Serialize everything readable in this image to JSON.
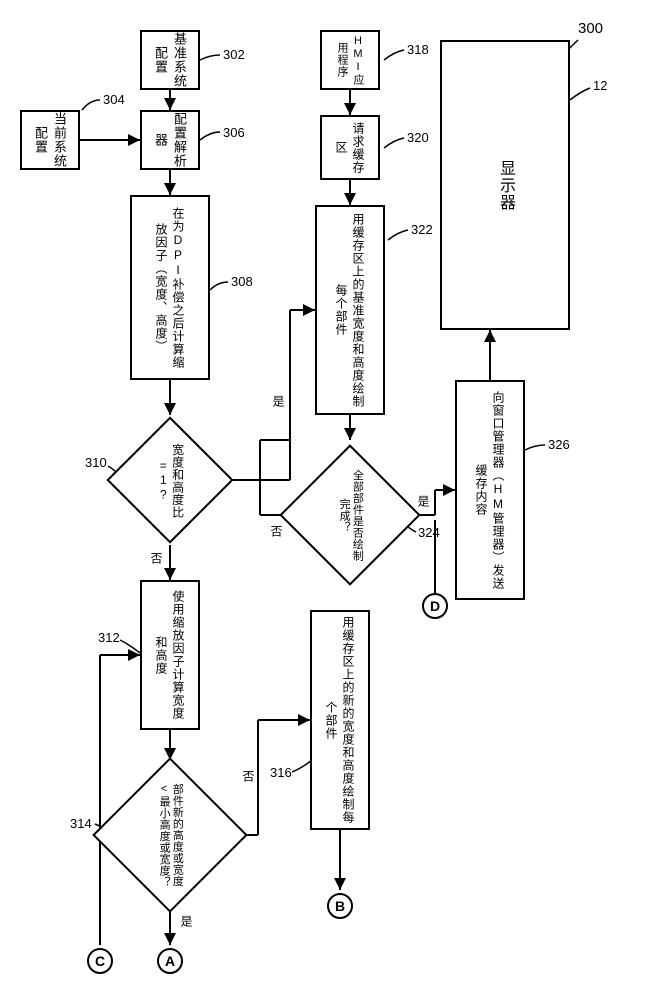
{
  "figure_id": "300",
  "nodes": {
    "n302": {
      "id": "302",
      "text": "基准系统配置"
    },
    "n304": {
      "id": "304",
      "text": "当前系统配置"
    },
    "n306": {
      "id": "306",
      "text": "配置解析器"
    },
    "n308": {
      "id": "308",
      "text": "在为DPI补偿之后计算缩放因子（宽度、高度）"
    },
    "n310": {
      "id": "310",
      "text": "宽度和高度比=1?"
    },
    "n312": {
      "id": "312",
      "text": "使用缩放因子计算宽度和高度"
    },
    "n314": {
      "id": "314",
      "text": "部件新的高度或宽度<最小高度或宽度？"
    },
    "n316": {
      "id": "316",
      "text": "用缓存区上的新的宽度和高度绘制每个部件"
    },
    "n318": {
      "id": "318",
      "text": "HMI应用程序"
    },
    "n320": {
      "id": "320",
      "text": "请求缓存区"
    },
    "n322": {
      "id": "322",
      "text": "用缓存区上的基准宽度和高度绘制每个部件"
    },
    "n324": {
      "id": "324",
      "text": "全部部件是否绘制完成？"
    },
    "n326": {
      "id": "326",
      "text": "向窗口管理器（HM管理器）发送缓存内容"
    },
    "n12": {
      "id": "12",
      "text": "显示器"
    }
  },
  "connectors": {
    "A": "A",
    "B": "B",
    "C": "C",
    "D": "D"
  },
  "edge_labels": {
    "yes": "是",
    "no": "否"
  },
  "leader_bracket": "╮"
}
